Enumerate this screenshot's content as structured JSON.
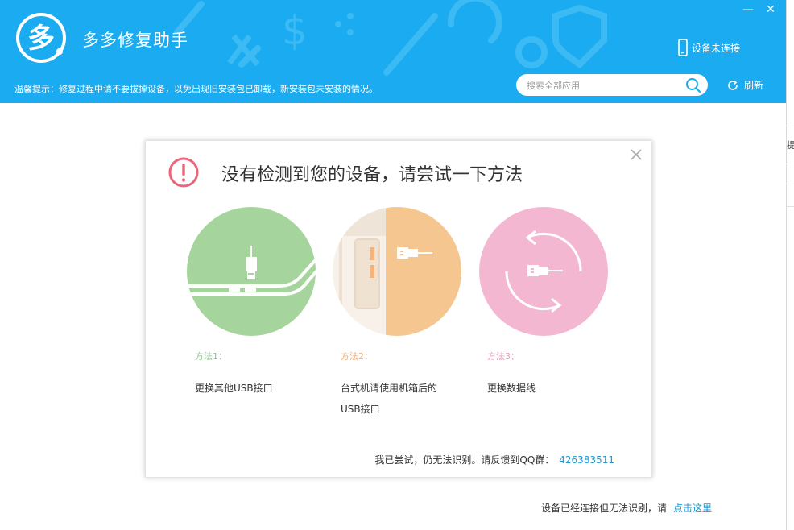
{
  "app": {
    "title": "多多修复助手"
  },
  "header": {
    "tip": "温馨提示：修复过程中请不要拔掉设备，以免出现旧安装包已卸载，新安装包未安装的情况。",
    "device_status": "设备未连接",
    "search_placeholder": "搜索全部应用",
    "refresh_label": "刷新",
    "window_minimize": "—",
    "window_close": "✕"
  },
  "dialog": {
    "title": "没有检测到您的设备，请尝试一下方法",
    "methods": [
      {
        "label": "方法1：",
        "desc": "更换其他USB接口"
      },
      {
        "label": "方法2：",
        "desc_line1": "台式机请使用机箱后的",
        "desc_line2": "USB接口"
      },
      {
        "label": "方法3：",
        "desc": "更换数据线"
      }
    ],
    "feedback_text": "我已尝试，仍无法识别。请反馈到QQ群：",
    "qq_group": "426383511"
  },
  "footer": {
    "note": "设备已经连接但无法识别，请",
    "link": "点击这里"
  },
  "edge_glyph": "提",
  "colors": {
    "header_bg": "#1aabf0",
    "method1": "#a5d49c",
    "method2": "#f5c690",
    "method3": "#f3b7d2",
    "warn": "#e8657a",
    "link": "#1b9ad6"
  }
}
